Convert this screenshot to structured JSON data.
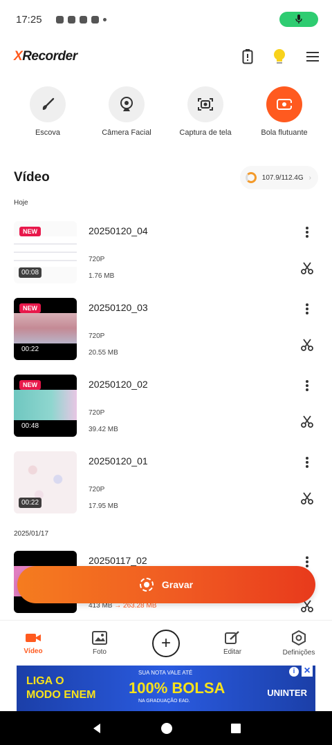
{
  "status_bar": {
    "time": "17:25"
  },
  "header": {
    "logo_x": "X",
    "logo_rest": "Recorder"
  },
  "tools": [
    {
      "label": "Escova",
      "icon": "brush-icon"
    },
    {
      "label": "Câmera Facial",
      "icon": "webcam-icon"
    },
    {
      "label": "Captura de tela",
      "icon": "screenshot-icon"
    },
    {
      "label": "Bola flutuante",
      "icon": "floating-ball-icon"
    }
  ],
  "section": {
    "title": "Vídeo",
    "storage": "107.9/112.4G"
  },
  "groups": [
    {
      "date": "Hoje"
    },
    {
      "date": "2025/01/17"
    }
  ],
  "videos": [
    {
      "title": "20250120_04",
      "resolution": "720P",
      "size": "1.76 MB",
      "duration": "00:08",
      "badge": "NEW"
    },
    {
      "title": "20250120_03",
      "resolution": "720P",
      "size": "20.55 MB",
      "duration": "00:22",
      "badge": "NEW"
    },
    {
      "title": "20250120_02",
      "resolution": "720P",
      "size": "39.42 MB",
      "duration": "00:48",
      "badge": "NEW"
    },
    {
      "title": "20250120_01",
      "resolution": "720P",
      "size": "17.95 MB",
      "duration": "00:22",
      "badge": ""
    },
    {
      "title": "20250117_02",
      "size_before": "413 MB",
      "size_after": "263.28 MB"
    }
  ],
  "record_button": {
    "label": "Gravar"
  },
  "bottom_nav": [
    {
      "label": "Vídeo"
    },
    {
      "label": "Foto"
    },
    {
      "label": ""
    },
    {
      "label": "Editar"
    },
    {
      "label": "Definições"
    }
  ],
  "ad": {
    "left_line1": "LIGA O",
    "left_line2": "MODO ENEM",
    "top": "SUA NOTA VALE ATÉ",
    "big": "100%",
    "big_suffix": "BOLSA",
    "small": "NA GRADUAÇÃO EAD.",
    "brand": "UNINTER"
  },
  "colors": {
    "accent": "#ff5a1f",
    "badge": "#e8184b",
    "mic": "#2ecc71"
  }
}
